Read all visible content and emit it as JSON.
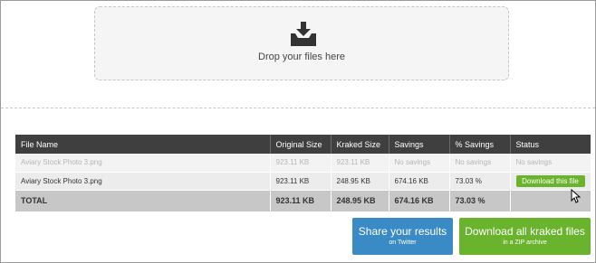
{
  "dropzone": {
    "icon": "download-tray-icon",
    "text": "Drop your files here"
  },
  "table": {
    "headers": [
      "File Name",
      "Original Size",
      "Kraked Size",
      "Savings",
      "% Savings",
      "Status"
    ],
    "rows": [
      {
        "file_name": "Aviary Stock Photo 3.png",
        "original_size": "923.11 KB",
        "kraked_size": "923.11 KB",
        "savings": "No savings",
        "percent_savings": "No savings",
        "status": "No savings"
      },
      {
        "file_name": "Aviary Stock Photo 3.png",
        "original_size": "923.11 KB",
        "kraked_size": "248.95 KB",
        "savings": "674.16 KB",
        "percent_savings": "73.03 %",
        "status_button": "Download this file"
      }
    ],
    "total": {
      "label": "TOTAL",
      "original_size": "923.11 KB",
      "kraked_size": "248.95 KB",
      "savings": "674.16 KB",
      "percent_savings": "73.03 %"
    }
  },
  "actions": {
    "share": {
      "label": "Share your results",
      "sub": "on Twitter"
    },
    "download_all": {
      "label": "Download all kraked files",
      "sub": "in a ZIP archive"
    }
  },
  "colors": {
    "header_bg": "#3f3f3f",
    "accent_green": "#6ab32d",
    "accent_blue": "#3a8bc5",
    "total_bg": "#c7c7c7"
  }
}
